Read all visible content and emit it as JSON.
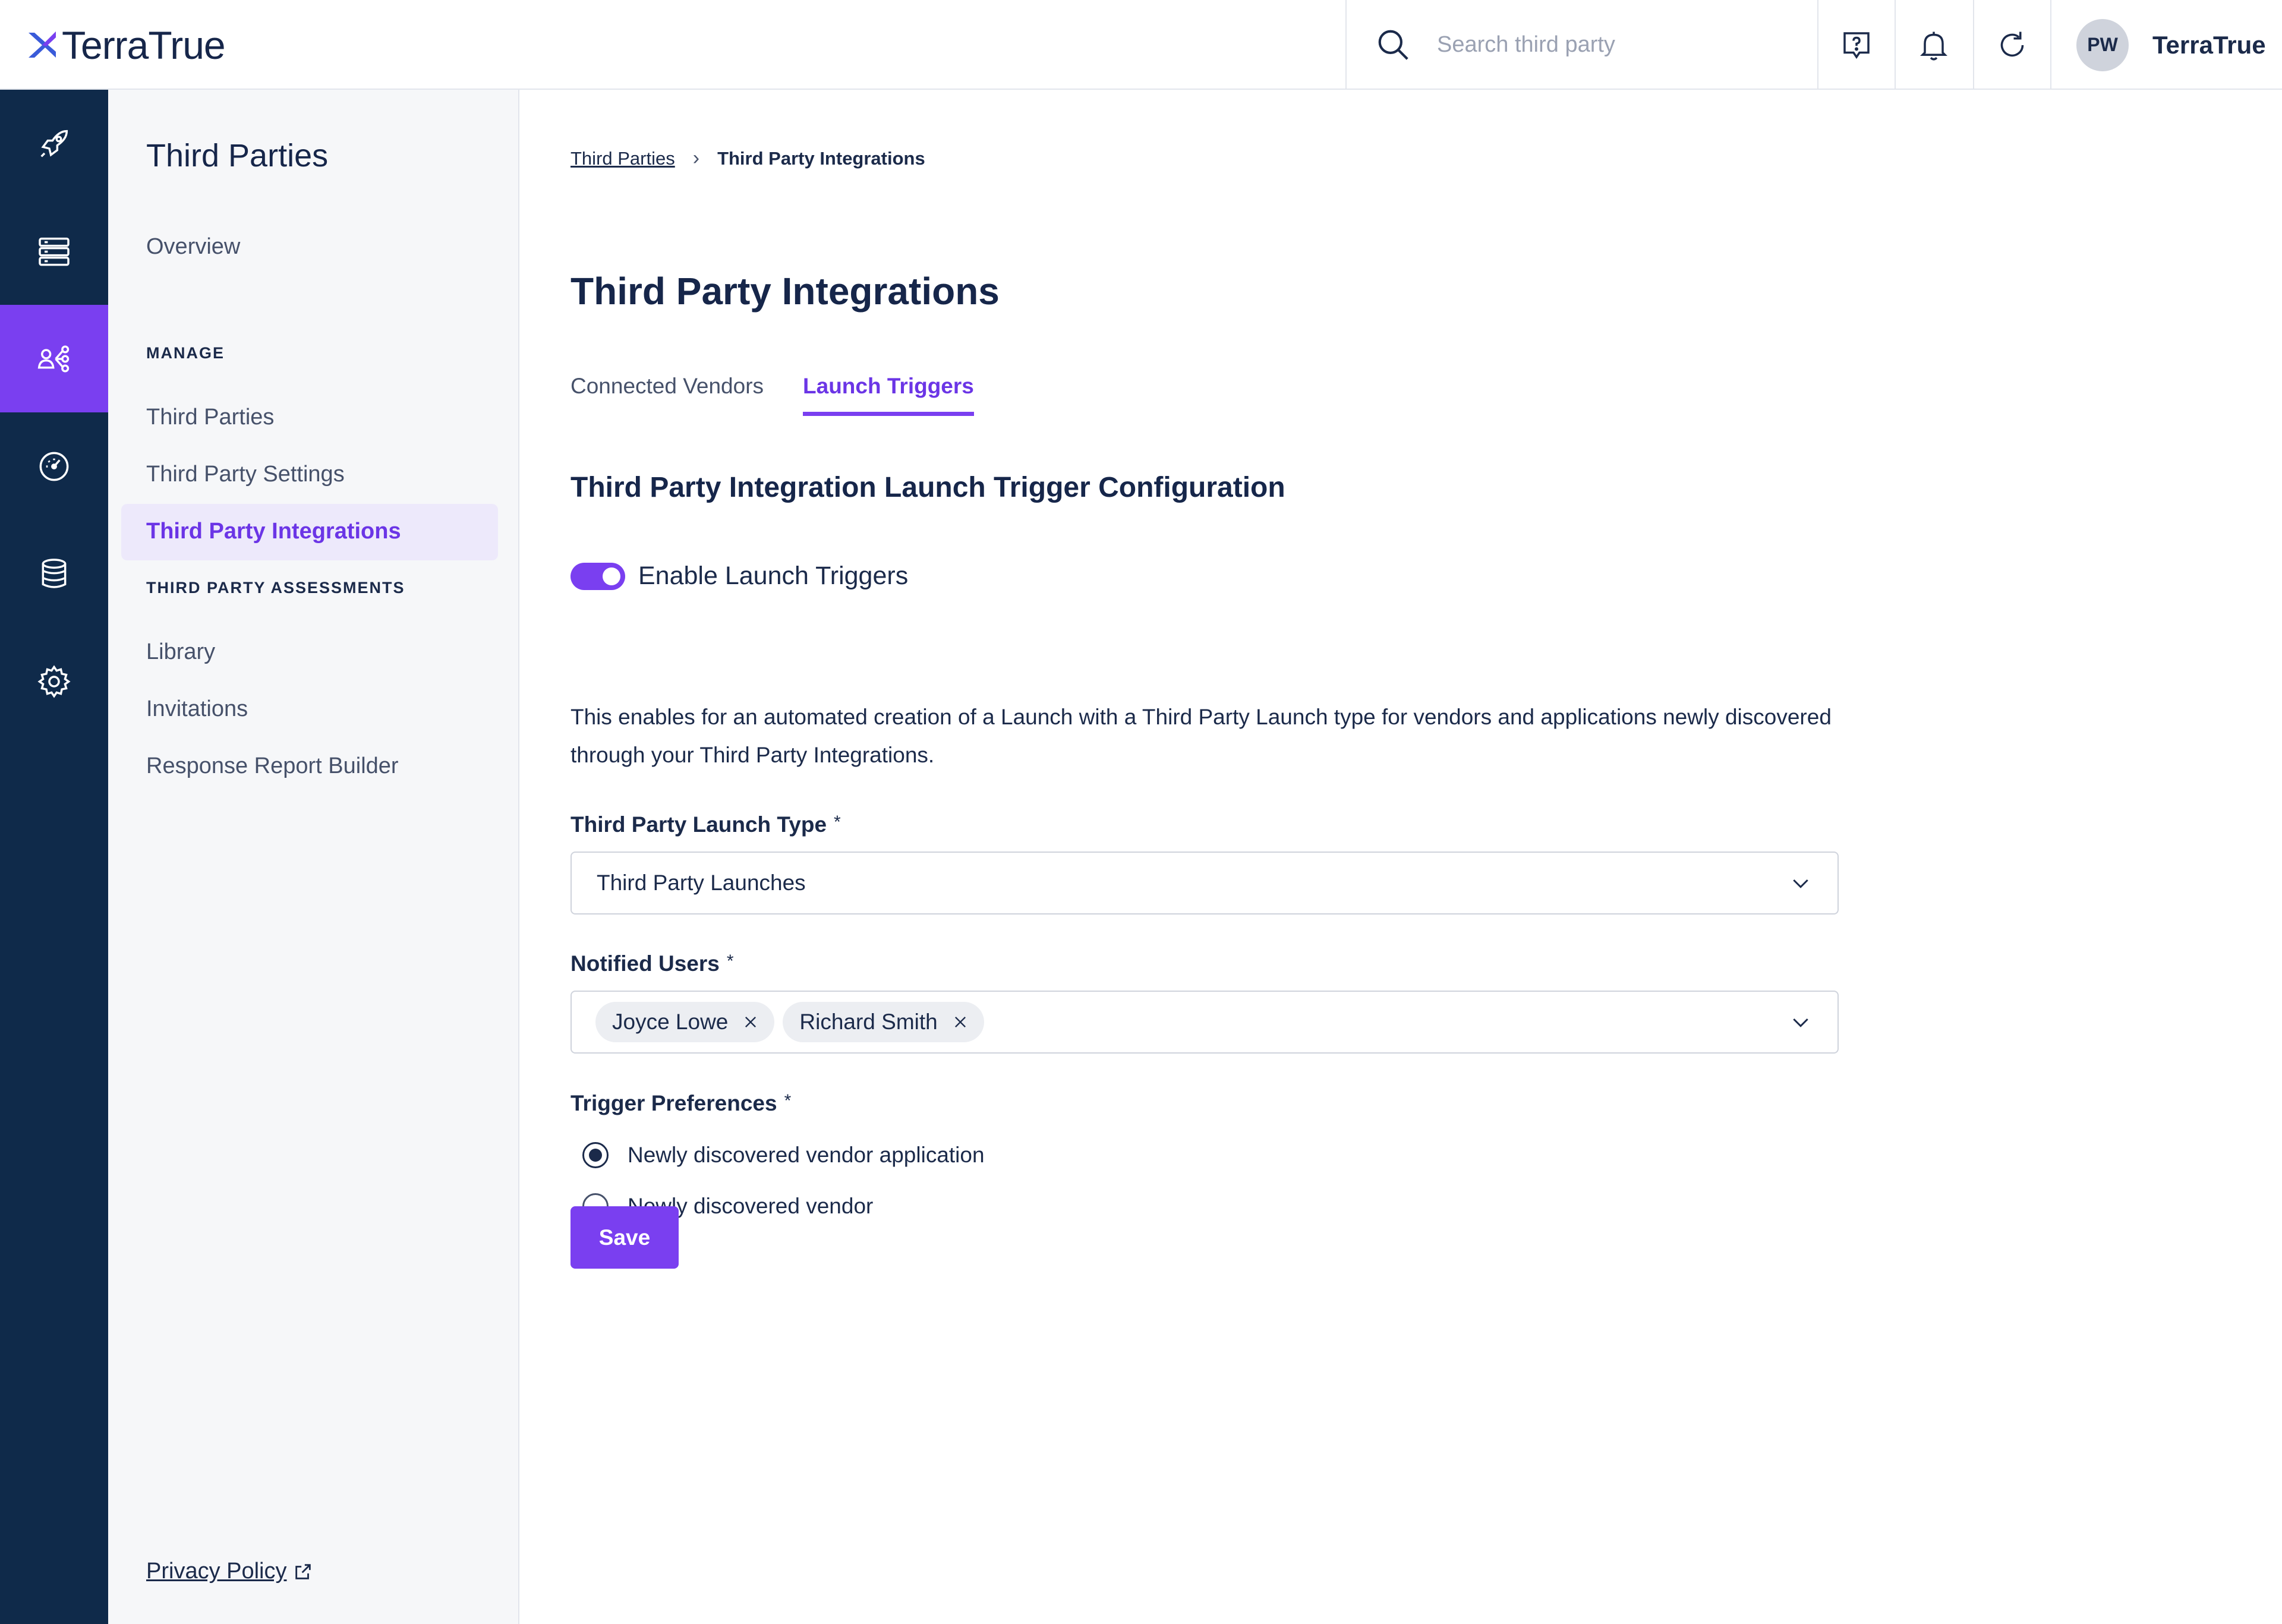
{
  "header": {
    "logo_text": "TerraTrue",
    "search_placeholder": "Search third party",
    "user_initials": "PW",
    "org_name": "TerraTrue",
    "accent_color": "#7a3ff0",
    "rail_color": "#0f2a4a"
  },
  "rail": {
    "items": [
      {
        "icon": "rocket-icon",
        "active": false
      },
      {
        "icon": "server-stack-icon",
        "active": false
      },
      {
        "icon": "people-network-icon",
        "active": true
      },
      {
        "icon": "gauge-icon",
        "active": false
      },
      {
        "icon": "database-icon",
        "active": false
      },
      {
        "icon": "gear-icon",
        "active": false
      }
    ]
  },
  "sidebar": {
    "title": "Third Parties",
    "overview": "Overview",
    "manage_heading": "MANAGE",
    "manage_items": [
      "Third Parties",
      "Third Party Settings",
      "Third Party Integrations"
    ],
    "assessments_heading": "THIRD PARTY ASSESSMENTS",
    "assessment_items": [
      "Library",
      "Invitations",
      "Response Report Builder"
    ],
    "privacy_policy": "Privacy Policy"
  },
  "breadcrumb": {
    "parent": "Third Parties",
    "separator": "›",
    "current": "Third Party Integrations"
  },
  "page": {
    "title": "Third Party Integrations",
    "tabs": [
      "Connected Vendors",
      "Launch Triggers"
    ],
    "active_tab": "Launch Triggers",
    "section_title": "Third Party Integration Launch Trigger Configuration",
    "toggle_label": "Enable Launch Triggers",
    "toggle_on": true,
    "description_line1": "This enables for an automated creation of a Launch with a Third Party Launch type for vendors and applications newly discovered",
    "description_line2": "through your Third Party Integrations."
  },
  "form": {
    "required_mark": "*",
    "launch_type_label": "Third Party Launch Type",
    "launch_type_value": "Third Party Launches",
    "notified_users_label": "Notified Users",
    "notified_users": [
      "Joyce Lowe",
      "Richard Smith"
    ],
    "trigger_label": "Trigger Preferences",
    "trigger_options": [
      "Newly discovered vendor application",
      "Newly discovered vendor"
    ],
    "trigger_selected": "Newly discovered vendor application",
    "save_label": "Save"
  }
}
